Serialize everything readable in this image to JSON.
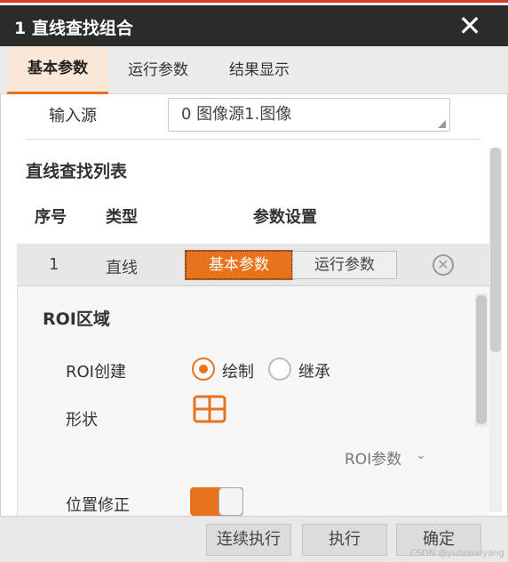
{
  "dialog": {
    "title": "1 直线查找组合",
    "close_glyph": "✕"
  },
  "tabs": [
    {
      "label": "基本参数",
      "active": true
    },
    {
      "label": "运行参数",
      "active": false
    },
    {
      "label": "结果显示",
      "active": false
    }
  ],
  "input_source": {
    "label": "输入源",
    "value": "0 图像源1.图像"
  },
  "line_list": {
    "title": "直线查找列表",
    "columns": [
      "序号",
      "类型",
      "参数设置"
    ],
    "rows": [
      {
        "index": "1",
        "type": "直线",
        "basic_button": "基本参数",
        "run_button": "运行参数",
        "delete_glyph": "✕"
      }
    ]
  },
  "roi": {
    "title": "ROI区域",
    "create_label": "ROI创建",
    "options": [
      {
        "label": "绘制",
        "checked": true
      },
      {
        "label": "继承",
        "checked": false
      }
    ],
    "shape_label": "形状",
    "shape_icon": "rect-roi-icon",
    "params_label": "ROI参数",
    "params_chevron": "⌄"
  },
  "position_correction": {
    "label": "位置修正",
    "enabled": true
  },
  "footer": {
    "continuous_run": "连续执行",
    "run": "执行",
    "confirm": "确定"
  },
  "watermark": "CSDN @yuhouxiyang",
  "colors": {
    "accent": "#e8731c",
    "titlebar": "#2b2b2b",
    "tab_active_bg": "#fce8d8"
  }
}
